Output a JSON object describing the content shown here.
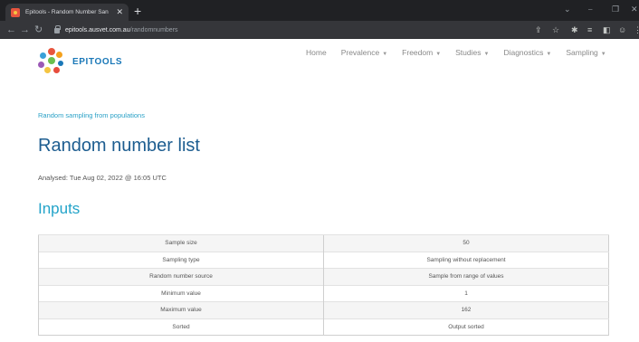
{
  "browser": {
    "tab_title": "Epitools - Random Number San",
    "tab_close": "✕",
    "new_tab": "+",
    "url_host": "epitools.ausvet.com.au",
    "url_path": "/randomnumbers"
  },
  "site": {
    "logo_text": "EPITOOLS",
    "nav": [
      {
        "label": "Home",
        "dropdown": false
      },
      {
        "label": "Prevalence",
        "dropdown": true
      },
      {
        "label": "Freedom",
        "dropdown": true
      },
      {
        "label": "Studies",
        "dropdown": true
      },
      {
        "label": "Diagnostics",
        "dropdown": true
      },
      {
        "label": "Sampling",
        "dropdown": true
      }
    ]
  },
  "page": {
    "breadcrumb": "Random sampling from populations",
    "title": "Random number list",
    "analysed": "Analysed: Tue Aug 02, 2022 @ 16:05 UTC",
    "inputs_heading": "Inputs"
  },
  "inputs": {
    "rows": [
      {
        "label": "Sample size",
        "value": "50"
      },
      {
        "label": "Sampling type",
        "value": "Sampling without replacement"
      },
      {
        "label": "Random number source",
        "value": "Sample from range of values"
      },
      {
        "label": "Minimum value",
        "value": "1"
      },
      {
        "label": "Maximum value",
        "value": "162"
      },
      {
        "label": "Sorted",
        "value": "Output sorted"
      }
    ]
  },
  "colors": {
    "brand_blue": "#1a78b8",
    "title_blue": "#1d5d90",
    "accent_cyan": "#22a3c9"
  },
  "icons": [
    "back-arrow-icon",
    "forward-arrow-icon",
    "reload-icon",
    "lock-icon",
    "share-icon",
    "star-icon",
    "extensions-icon",
    "reading-list-icon",
    "sidebar-icon",
    "profile-icon",
    "menu-icon"
  ]
}
